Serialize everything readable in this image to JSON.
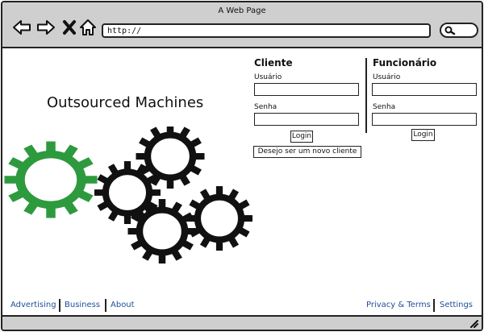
{
  "window": {
    "title": "A Web Page"
  },
  "toolbar": {
    "url": "http://",
    "icons": [
      "back-arrow-icon",
      "forward-arrow-icon",
      "close-x-icon",
      "home-icon",
      "search-icon"
    ]
  },
  "site": {
    "title": "Outsourced Machines"
  },
  "gears": {
    "icon": "gears-illustration",
    "accent_color": "#2e9a3e",
    "default_color": "#111111"
  },
  "cliente": {
    "heading": "Cliente",
    "user_label": "Usuário",
    "pass_label": "Senha",
    "login_button": "Login",
    "new_client_button": "Desejo ser um novo cliente"
  },
  "funcionario": {
    "heading": "Funcionário",
    "user_label": "Usuário",
    "pass_label": "Senha",
    "login_button": "Login"
  },
  "footer": {
    "left_links": [
      "Advertising",
      "Business",
      "About"
    ],
    "right_links": [
      "Privacy & Terms",
      "Settings"
    ],
    "link_color": "#1f4f9a"
  }
}
